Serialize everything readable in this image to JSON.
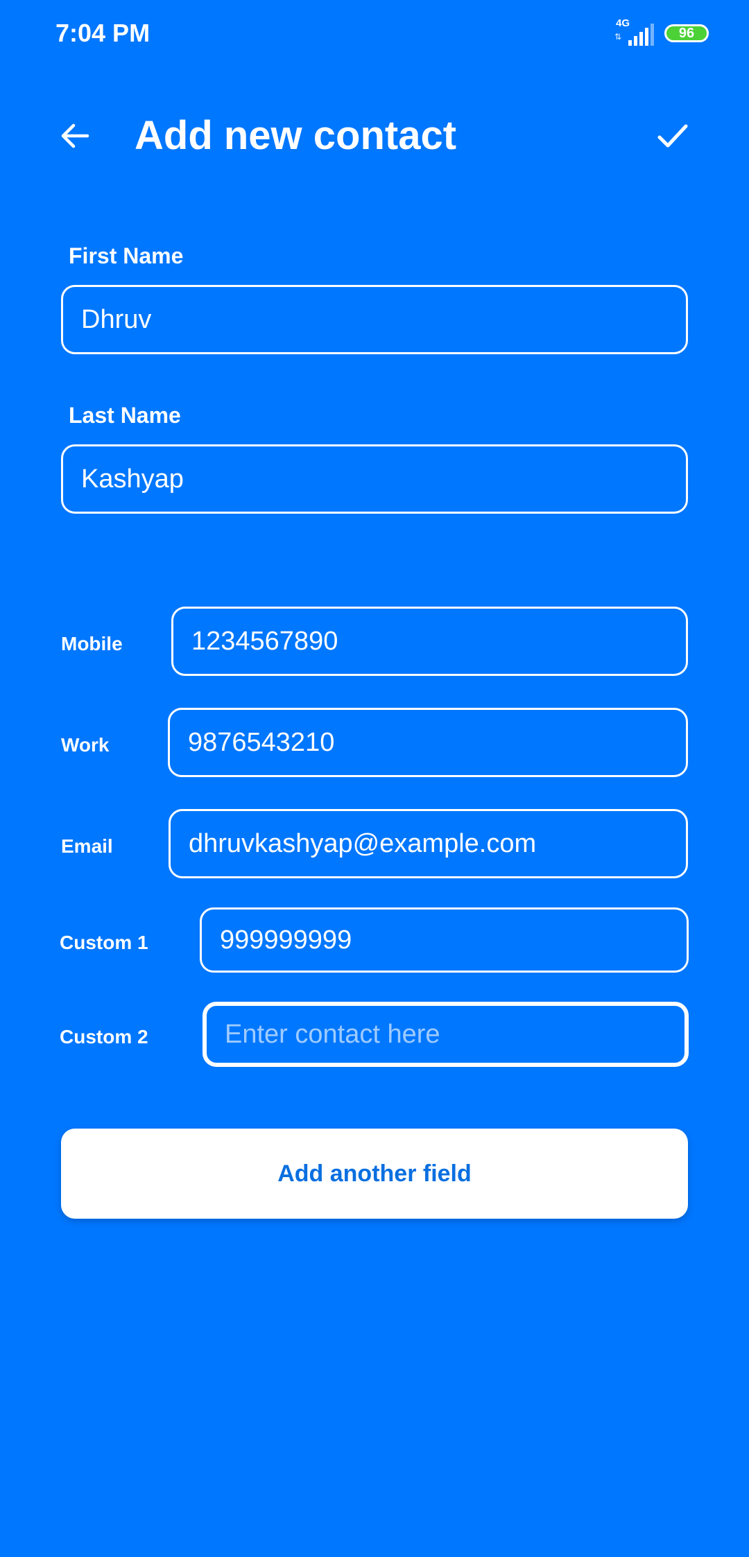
{
  "status_bar": {
    "time": "7:04 PM",
    "network_type": "4G",
    "battery_level": "96",
    "battery_color": "#4cd137"
  },
  "header": {
    "title": "Add new contact",
    "back_icon": "arrow-left-icon",
    "save_icon": "checkmark-icon"
  },
  "form": {
    "first_name": {
      "label": "First Name",
      "value": "Dhruv"
    },
    "last_name": {
      "label": "Last Name",
      "value": "Kashyap"
    },
    "fields": [
      {
        "label": "Mobile",
        "value": "1234567890",
        "placeholder": ""
      },
      {
        "label": "Work",
        "value": "9876543210",
        "placeholder": ""
      },
      {
        "label": "Email",
        "value": "dhruvkashyap@example.com",
        "placeholder": ""
      },
      {
        "label": "Custom 1",
        "value": "999999999",
        "placeholder": ""
      },
      {
        "label": "Custom 2",
        "value": "",
        "placeholder": "Enter contact here"
      }
    ]
  },
  "actions": {
    "add_field_label": "Add another field"
  },
  "colors": {
    "background": "#0077ff",
    "button_text": "#0a6fe0"
  }
}
